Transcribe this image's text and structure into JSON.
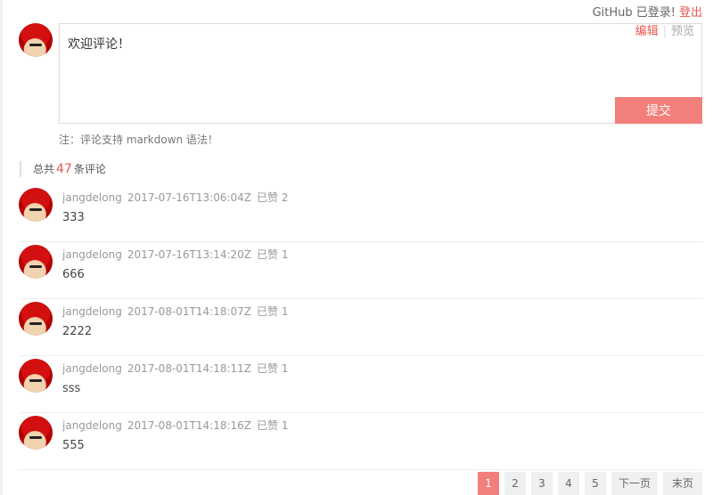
{
  "auth": {
    "status": "GitHub 已登录!",
    "logout": "登出"
  },
  "editor": {
    "tab_edit": "编辑",
    "tab_preview": "预览",
    "text": "欢迎评论！",
    "submit": "提交",
    "note": "注：评论支持 markdown 语法！"
  },
  "total": {
    "prefix": "总共",
    "count": "47",
    "suffix": "条评论"
  },
  "comments": [
    {
      "user": "jangdelong",
      "time": "2017-07-16T13:06:04Z",
      "likes": "已赞 2",
      "text": "333"
    },
    {
      "user": "jangdelong",
      "time": "2017-07-16T13:14:20Z",
      "likes": "已赞 1",
      "text": "666"
    },
    {
      "user": "jangdelong",
      "time": "2017-08-01T14:18:07Z",
      "likes": "已赞 1",
      "text": "2222"
    },
    {
      "user": "jangdelong",
      "time": "2017-08-01T14:18:11Z",
      "likes": "已赞 1",
      "text": "sss"
    },
    {
      "user": "jangdelong",
      "time": "2017-08-01T14:18:16Z",
      "likes": "已赞 1",
      "text": "555"
    }
  ],
  "pager": {
    "pages": [
      "1",
      "2",
      "3",
      "4",
      "5"
    ],
    "next": "下一页",
    "last": "末页",
    "current": "1"
  },
  "colors": {
    "accent": "#f37f7a",
    "link": "#e55a52"
  }
}
